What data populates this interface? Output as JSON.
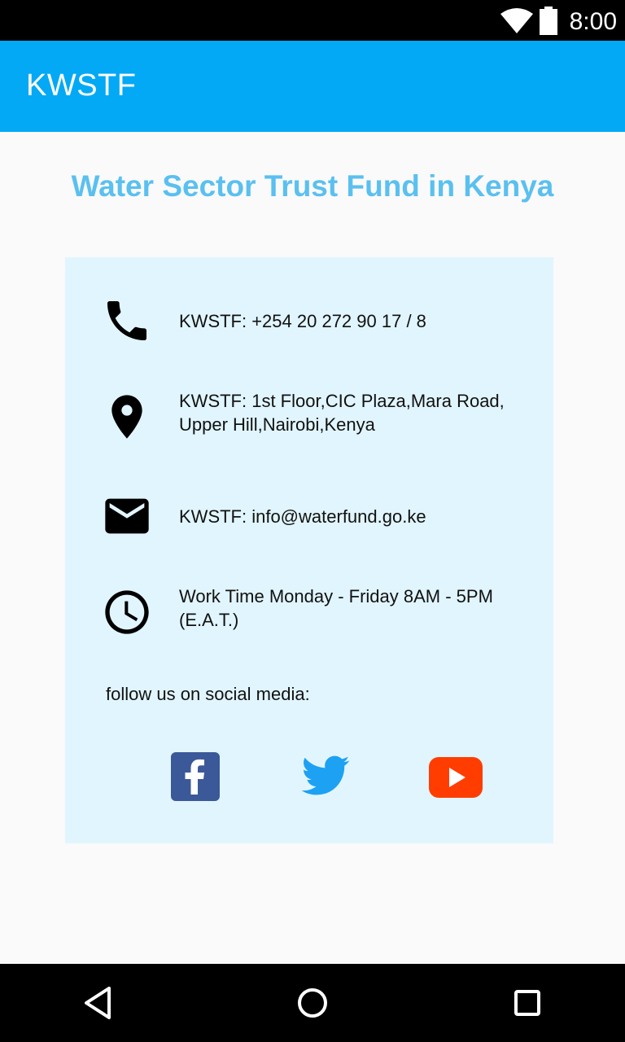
{
  "status_bar": {
    "time": "8:00",
    "icons": [
      "wifi-icon",
      "battery-icon"
    ]
  },
  "app_bar": {
    "title": "KWSTF",
    "color": "#03a9f4"
  },
  "page": {
    "heading": "Water Sector Trust Fund in Kenya",
    "heading_color": "#5ac0f0",
    "card_color": "#e1f5fe"
  },
  "contacts": [
    {
      "icon": "phone-icon",
      "text": "KWSTF: +254 20 272 90 17 / 8"
    },
    {
      "icon": "location-pin-icon",
      "text_line1": "KWSTF: 1st Floor,CIC Plaza,Mara Road,",
      "text_line2": "Upper Hill,Nairobi,Kenya"
    },
    {
      "icon": "email-icon",
      "text": "KWSTF: info@waterfund.go.ke"
    },
    {
      "icon": "clock-icon",
      "text_line1": "Work Time Monday - Friday 8AM - 5PM",
      "text_line2": "(E.A.T.)"
    }
  ],
  "social": {
    "label": "follow us on social media:",
    "links": [
      {
        "icon": "facebook-icon",
        "color": "#3b5998"
      },
      {
        "icon": "twitter-icon",
        "color": "#1da1f2"
      },
      {
        "icon": "youtube-icon",
        "color": "#ff3d00"
      }
    ]
  },
  "nav_bar": {
    "buttons": [
      "back-icon",
      "home-icon",
      "recents-icon"
    ]
  }
}
